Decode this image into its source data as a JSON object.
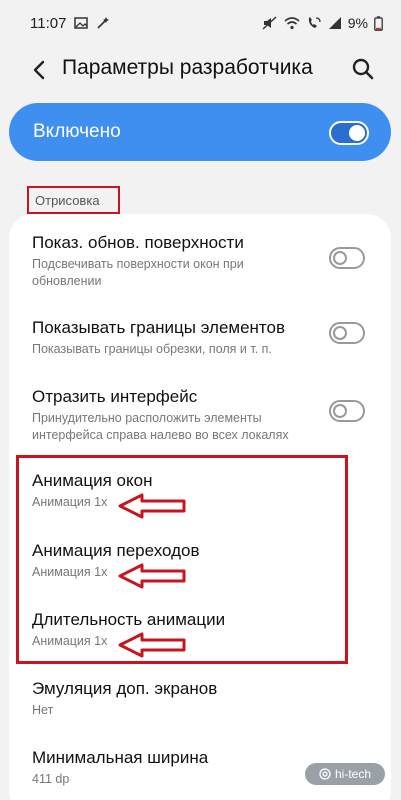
{
  "status_bar": {
    "time": "11:07",
    "battery": "9%"
  },
  "appbar": {
    "title": "Параметры разработчика",
    "back_icon": "chevron-left-icon",
    "search_icon": "search-icon"
  },
  "master": {
    "label": "Включено",
    "enabled": true
  },
  "section": {
    "header": "Отрисовка"
  },
  "items": [
    {
      "title": "Показ. обнов. поверхности",
      "subtitle_lines": [
        "Подсвечивать поверхности окон при",
        "обновлении"
      ],
      "toggle": false
    },
    {
      "title": "Показывать границы элементов",
      "subtitle_lines": [
        "Показывать границы обрезки, поля и т. п."
      ],
      "toggle": false
    },
    {
      "title": "Отразить интерфейс",
      "subtitle_lines": [
        "Принудительно расположить элементы",
        "интерфейса справа налево во всех локалях"
      ],
      "toggle": false
    },
    {
      "title": "Анимация окон",
      "subtitle_lines": [
        "Анимация 1x"
      ]
    },
    {
      "title": "Анимация переходов",
      "subtitle_lines": [
        "Анимация 1x"
      ]
    },
    {
      "title": "Длительность анимации",
      "subtitle_lines": [
        "Анимация 1x"
      ]
    },
    {
      "title": "Эмуляция доп. экранов",
      "subtitle_lines": [
        "Нет"
      ]
    },
    {
      "title": "Минимальная ширина",
      "subtitle_lines": [
        "411 dp"
      ]
    }
  ],
  "watermark": "hi-tech",
  "colors": {
    "accent": "#3f8ff0",
    "annotation_red": "#c8141e"
  }
}
